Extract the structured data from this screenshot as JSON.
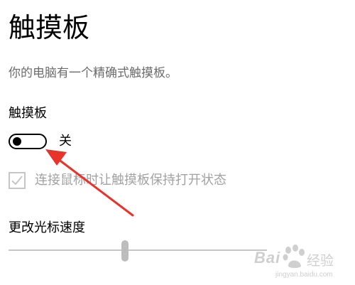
{
  "page": {
    "title": "触摸板",
    "description": "你的电脑有一个精确式触摸板。"
  },
  "touchpad": {
    "section_label": "触摸板",
    "toggle_state_label": "关",
    "toggle_on": false
  },
  "mouse_option": {
    "label": "连接鼠标时让触摸板保持打开状态",
    "checked": true,
    "disabled": true
  },
  "cursor_speed": {
    "label": "更改光标速度",
    "value_fraction": 0.45
  },
  "watermark": {
    "brand": "Bai",
    "brand_suffix": "经验",
    "url": "jingyan.baidu.com"
  },
  "colors": {
    "annotation_arrow": "#e8332b",
    "disabled_text": "#a2a2a2",
    "description_text": "#6b6b6b",
    "track": "#c6c6c6"
  }
}
